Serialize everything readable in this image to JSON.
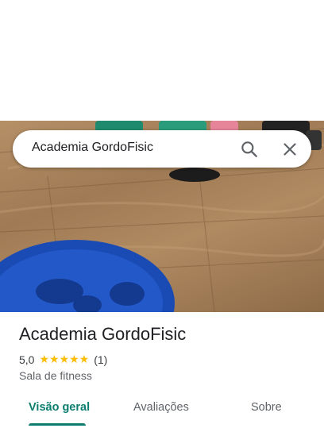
{
  "search": {
    "query": "Academia GordoFisic",
    "search_icon": "search-icon",
    "clear_icon": "close-icon"
  },
  "place": {
    "title": "Academia GordoFisic",
    "rating": "5,0",
    "stars": "★★★★★",
    "stars_value": 5,
    "review_count": "(1)",
    "category": "Sala de fitness"
  },
  "tabs": [
    {
      "label": "Visão geral",
      "active": true
    },
    {
      "label": "Avaliações",
      "active": false
    },
    {
      "label": "Sobre",
      "active": false
    }
  ],
  "colors": {
    "accent": "#0b7d6f",
    "star": "#fbbc04",
    "text_primary": "#202124",
    "text_secondary": "#5f6368"
  }
}
